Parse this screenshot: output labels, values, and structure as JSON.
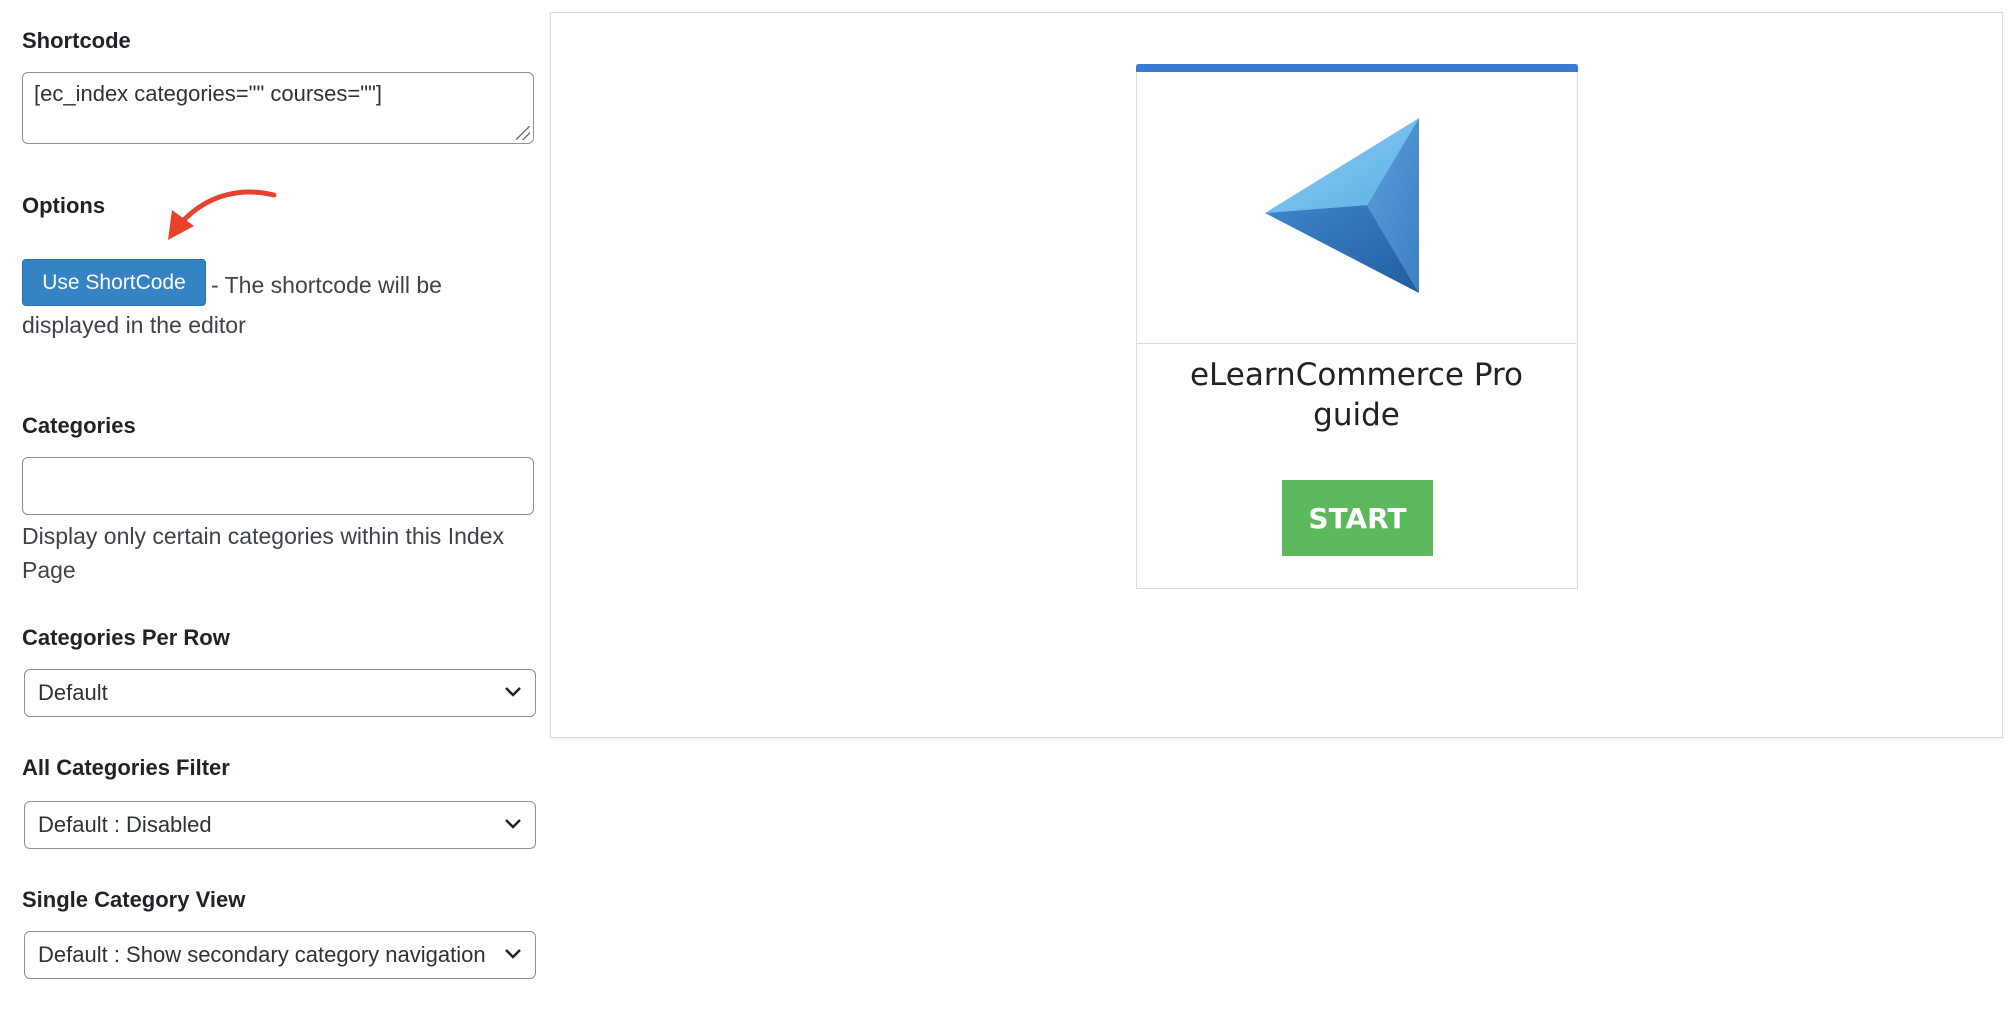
{
  "sidebar": {
    "shortcode": {
      "label": "Shortcode",
      "value": "[ec_index categories=\"\" courses=\"\"]"
    },
    "options": {
      "label": "Options",
      "button_label": "Use ShortCode",
      "description": "- The shortcode will be displayed in the editor"
    },
    "categories": {
      "label": "Categories",
      "value": "",
      "description": "Display only certain categories within this Index Page"
    },
    "categories_per_row": {
      "label": "Categories Per Row",
      "selected": "Default"
    },
    "all_categories_filter": {
      "label": "All Categories Filter",
      "selected": "Default : Disabled"
    },
    "single_category_view": {
      "label": "Single Category View",
      "selected": "Default : Show secondary category navigation"
    }
  },
  "preview": {
    "card": {
      "title": "eLearnCommerce Pro guide",
      "button_label": "START",
      "image_icon": "blue-triangle-logo"
    }
  },
  "colors": {
    "primary_button": "#3582c4",
    "start_button": "#5cb85c",
    "card_top_bar": "#3a7bd5",
    "annotation_arrow": "#e8412c"
  }
}
